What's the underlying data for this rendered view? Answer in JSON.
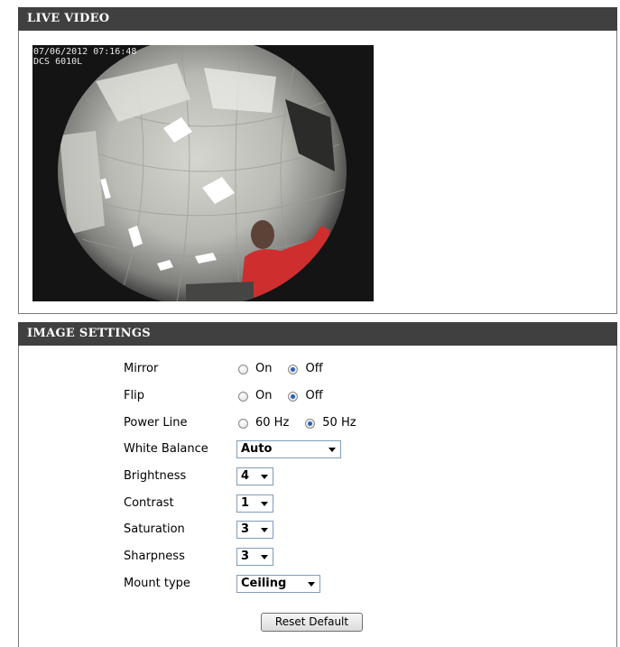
{
  "live_video": {
    "title": "LIVE VIDEO",
    "osd_datetime": "07/06/2012 07:16:48",
    "osd_camera": "DCS 6010L"
  },
  "image_settings": {
    "title": "IMAGE SETTINGS",
    "mirror": {
      "label": "Mirror",
      "options": [
        "On",
        "Off"
      ],
      "selected": "Off"
    },
    "flip": {
      "label": "Flip",
      "options": [
        "On",
        "Off"
      ],
      "selected": "Off"
    },
    "power_line": {
      "label": "Power Line",
      "options": [
        "60 Hz",
        "50 Hz"
      ],
      "selected": "50 Hz"
    },
    "white_balance": {
      "label": "White Balance",
      "value": "Auto"
    },
    "brightness": {
      "label": "Brightness",
      "value": "4"
    },
    "contrast": {
      "label": "Contrast",
      "value": "1"
    },
    "saturation": {
      "label": "Saturation",
      "value": "3"
    },
    "sharpness": {
      "label": "Sharpness",
      "value": "3"
    },
    "mount_type": {
      "label": "Mount type",
      "value": "Ceiling"
    },
    "reset_label": "Reset Default"
  }
}
